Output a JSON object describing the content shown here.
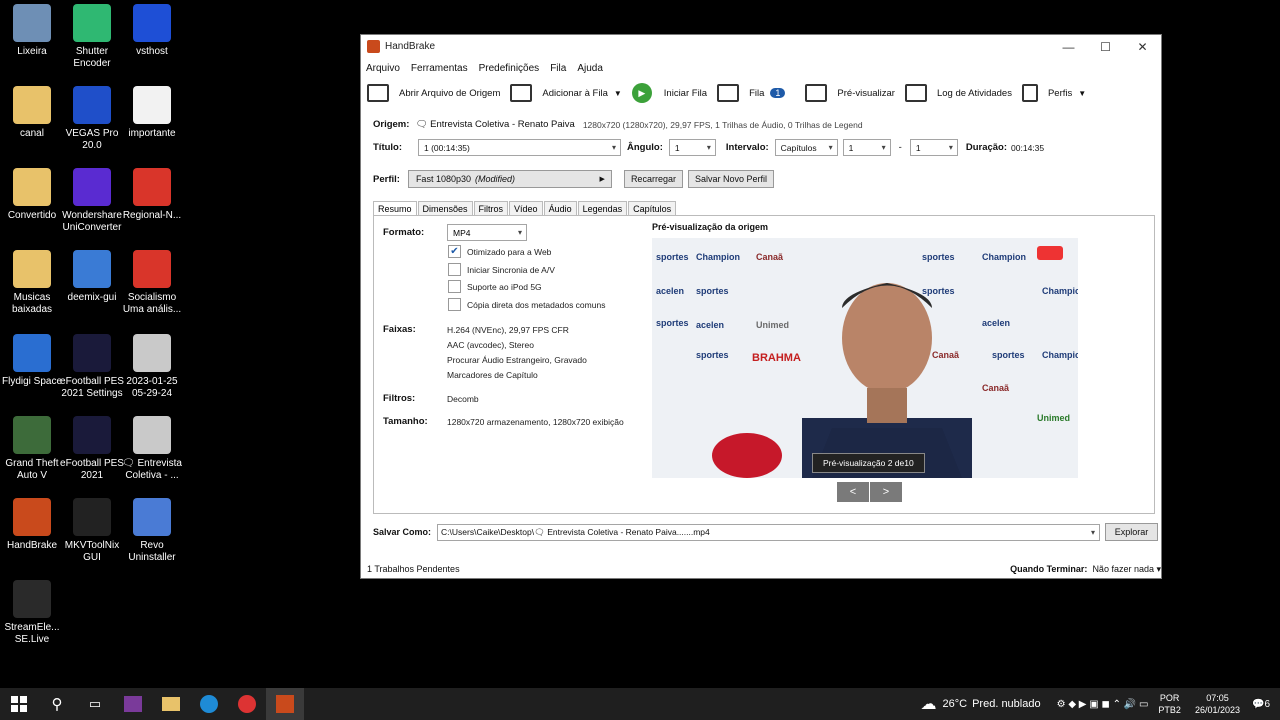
{
  "desktop": {
    "icons": [
      {
        "label": "Lixeira",
        "color": "#6e8fb5"
      },
      {
        "label": "Shutter Encoder",
        "color": "#2fb872"
      },
      {
        "label": "vsthost",
        "color": "#1e4fd6"
      },
      {
        "label": "canal",
        "color": "#e8c26a"
      },
      {
        "label": "VEGAS Pro 20.0",
        "color": "#1f4fc9"
      },
      {
        "label": "importante",
        "color": "#f2f2f2"
      },
      {
        "label": "Convertido",
        "color": "#e8c26a"
      },
      {
        "label": "Wondershare UniConverter",
        "color": "#5a2bd1"
      },
      {
        "label": "Regional-N...",
        "color": "#d9352a"
      },
      {
        "label": "Musicas baixadas",
        "color": "#e8c26a"
      },
      {
        "label": "deemix-gui",
        "color": "#3a7bd5"
      },
      {
        "label": "Socialismo Uma anális...",
        "color": "#d9352a"
      },
      {
        "label": "Flydigi Space",
        "color": "#2a6ed1"
      },
      {
        "label": "eFootball PES 2021 Settings",
        "color": "#1a1a3a"
      },
      {
        "label": "2023-01-25 05-29-24",
        "color": "#c9c9c9"
      },
      {
        "label": "Grand Theft Auto V",
        "color": "#3d6b3a"
      },
      {
        "label": "eFootball PES 2021",
        "color": "#1a1a3a"
      },
      {
        "label": "🗨 Entrevista Coletiva - ...",
        "color": "#c9c9c9"
      },
      {
        "label": "HandBrake",
        "color": "#c94a1c"
      },
      {
        "label": "MKVToolNix GUI",
        "color": "#222"
      },
      {
        "label": "Revo Uninstaller",
        "color": "#4a7bd5"
      },
      {
        "label": "StreamEle... SE.Live",
        "color": "#2a2a2a"
      }
    ]
  },
  "window": {
    "title": "HandBrake",
    "controls": [
      "—",
      "☐",
      "✕"
    ],
    "menu": [
      "Arquivo",
      "Ferramentas",
      "Predefinições",
      "Fila",
      "Ajuda"
    ],
    "toolbar": {
      "open_source": "Abrir Arquivo de Origem",
      "add_queue": "Adicionar à Fila",
      "start_queue": "Iniciar Fila",
      "queue": "Fila",
      "queue_count": "1",
      "preview": "Pré-visualizar",
      "activity_log": "Log de Atividades",
      "presets": "Perfis"
    },
    "source": {
      "label": "Origem:",
      "name": "🗨 Entrevista Coletiva - Renato Paiva",
      "info": "1280x720 (1280x720), 29,97 FPS, 1 Trilhas de Áudio, 0 Trilhas de Legend"
    },
    "title_row": {
      "title_label": "Título:",
      "title_value": "1  (00:14:35)",
      "angle_label": "Ângulo:",
      "angle_value": "1",
      "range_label": "Intervalo:",
      "range_type": "Capítulos",
      "range_start": "1",
      "range_sep": "-",
      "range_end": "1",
      "duration_label": "Duração:",
      "duration_value": "00:14:35"
    },
    "preset": {
      "label": "Perfil:",
      "value": "Fast 1080p30",
      "modified": "(Modified)",
      "reload": "Recarregar",
      "save_new": "Salvar Novo Perfil"
    },
    "tabs": [
      "Resumo",
      "Dimensões",
      "Filtros",
      "Vídeo",
      "Áudio",
      "Legendas",
      "Capítulos"
    ],
    "summary": {
      "format_label": "Formato:",
      "format_value": "MP4",
      "checks": [
        {
          "label": "Otimizado para a Web",
          "checked": true
        },
        {
          "label": "Iniciar Sincronia de A/V",
          "checked": false
        },
        {
          "label": "Suporte ao iPod 5G",
          "checked": false
        },
        {
          "label": "Cópia direta dos metadados comuns",
          "checked": false
        }
      ],
      "tracks_label": "Faixas:",
      "tracks": [
        "H.264 (NVEnc), 29,97 FPS CFR",
        "AAC (avcodec), Stereo",
        "Procurar Áudio Estrangeiro, Gravado",
        "Marcadores de Capítulo"
      ],
      "filters_label": "Filtros:",
      "filters_value": "Decomb",
      "size_label": "Tamanho:",
      "size_value": "1280x720 armazenamento, 1280x720 exibição",
      "preview_title": "Pré-visualização da origem",
      "preview_caption": "Pré-visualização 2 de10",
      "prev_btn": "<",
      "next_btn": ">"
    },
    "save_as": {
      "label": "Salvar Como:",
      "path": "C:\\Users\\Caike\\Desktop\\🗨 Entrevista Coletiva - Renato Paiva.......mp4",
      "browse": "Explorar"
    },
    "status": {
      "pending": "1 Trabalhos Pendentes",
      "when_done_label": "Quando Terminar:",
      "when_done_value": "Não fazer nada ▾"
    }
  },
  "taskbar": {
    "weather_temp": "26°C",
    "weather_desc": "Pred. nublado",
    "lang_top": "POR",
    "lang_bottom": "PTB2",
    "time": "07:05",
    "date": "26/01/2023",
    "notif": "6"
  }
}
